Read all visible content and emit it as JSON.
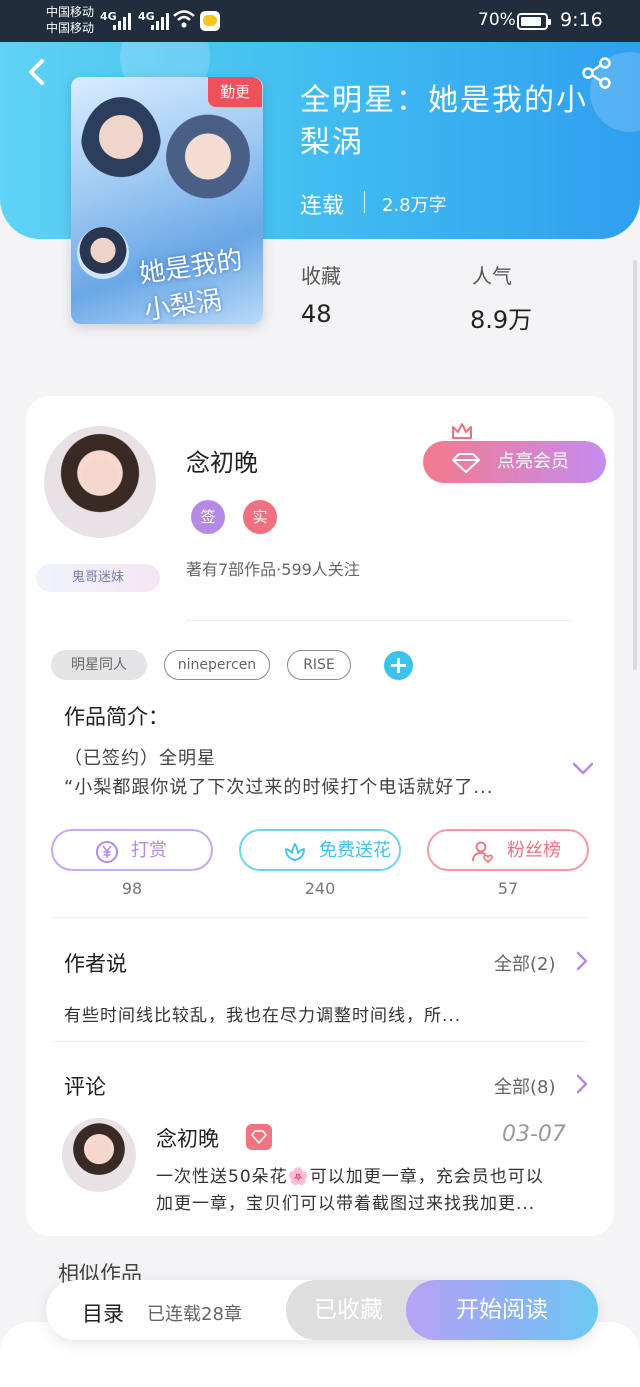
{
  "status_bar": {
    "carrier_1": "中国移动",
    "carrier_2": "中国移动",
    "network": "4G",
    "battery": "70%",
    "time": "9:16"
  },
  "book": {
    "badge": "勤更",
    "title": "全明星：她是我的小梨涡",
    "cover_text": "她是我的小梨涡",
    "status": "连载",
    "word_count": "2.8万字",
    "stats": [
      {
        "label": "收藏",
        "value": "48"
      },
      {
        "label": "人气",
        "value": "8.9万"
      }
    ]
  },
  "author": {
    "name": "念初晚",
    "vip_button": "点亮会员",
    "badges": [
      {
        "label": "签",
        "color": "#b58ae6"
      },
      {
        "label": "实",
        "color": "#f07080"
      }
    ],
    "fan_tag": "鬼哥迷妹",
    "meta": "著有7部作品·599人关注"
  },
  "tags": [
    "明星同人",
    "ninepercen",
    "RISE"
  ],
  "intro": {
    "title": "作品简介：",
    "line_1": "（已签约）全明星",
    "line_2": "“小梨都跟你说了下次过来的时候打个电话就好了..."
  },
  "actions": [
    {
      "label": "打赏",
      "count": "98",
      "color": "#b58ae6"
    },
    {
      "label": "免费送花",
      "count": "240",
      "color": "#3cc3ec"
    },
    {
      "label": "粉丝榜",
      "count": "57",
      "color": "#f07080"
    }
  ],
  "author_says": {
    "title": "作者说",
    "all_link": "全部(2)",
    "text": "有些时间线比较乱，我也在尽力调整时间线，所..."
  },
  "comments": {
    "title": "评论",
    "all_link": "全部(8)",
    "item": {
      "name": "念初晚",
      "date": "03-07",
      "line_1": "一次性送50朵花🌸可以加更一章，充会员也可以",
      "line_2": "加更一章，宝贝们可以带着截图过来找我加更..."
    }
  },
  "similar_title": "相似作品",
  "bottom_bar": {
    "toc": "目录",
    "chapters": "已连载28章",
    "collected": "已收藏",
    "start_reading": "开始阅读"
  },
  "colors": {
    "header_gradient_start": "#5fd2f5",
    "header_gradient_end": "#2f9ff0",
    "accent_purple": "#b58ae6",
    "accent_blue": "#3cc3ec",
    "accent_pink": "#f07080"
  }
}
